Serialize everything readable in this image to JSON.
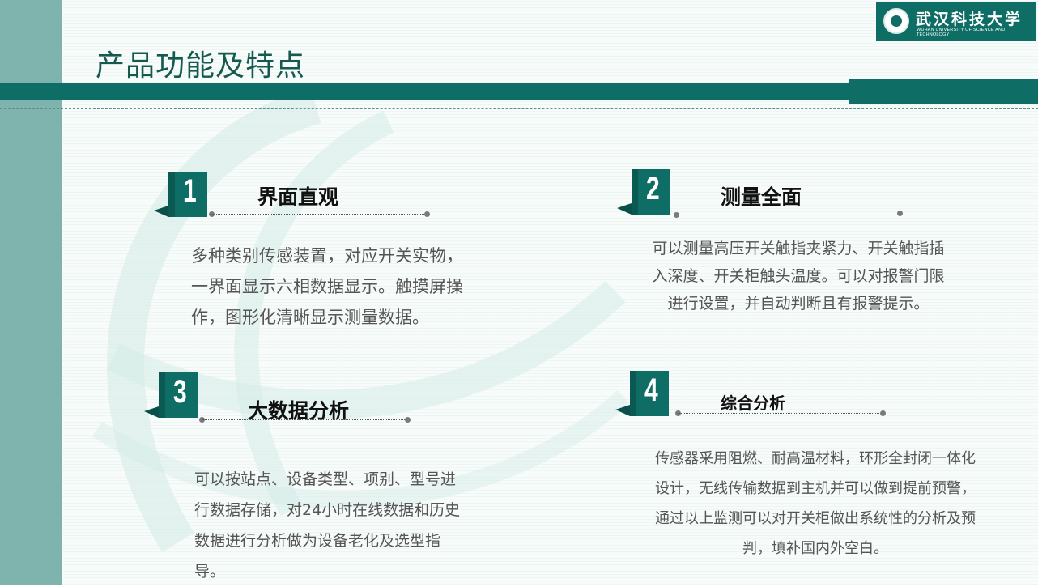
{
  "title": "产品功能及特点",
  "logo": {
    "name_cn": "武汉科技大学",
    "name_en": "WUHAN UNIVERSITY OF SCIENCE AND TECHNOLOGY"
  },
  "features": [
    {
      "number": "1",
      "heading": "界面直观",
      "text": "多种类别传感装置，对应开关实物，一界面显示六相数据显示。触摸屏操作，图形化清晰显示测量数据。"
    },
    {
      "number": "2",
      "heading": "测量全面",
      "text": "可以测量高压开关触指夹紧力、开关触指插入深度、开关柜触头温度。可以对报警门限进行设置，并自动判断且有报警提示。"
    },
    {
      "number": "3",
      "heading": "大数据分析",
      "text": "可以按站点、设备类型、项别、型号进行数据存储，对24小时在线数据和历史数据进行分析做为设备老化及选型指导。"
    },
    {
      "number": "4",
      "heading": "综合分析",
      "text": "传感器采用阻燃、耐高温材料，环形全封闭一体化设计，无线传输数据到主机并可以做到提前预警，通过以上监测可以对开关柜做出系统性的分析及预判，填补国内外空白。"
    }
  ],
  "colors": {
    "accent": "#0e6e66",
    "side_band": "#7fb3ad",
    "title": "#16594f",
    "body_text": "#555555"
  }
}
